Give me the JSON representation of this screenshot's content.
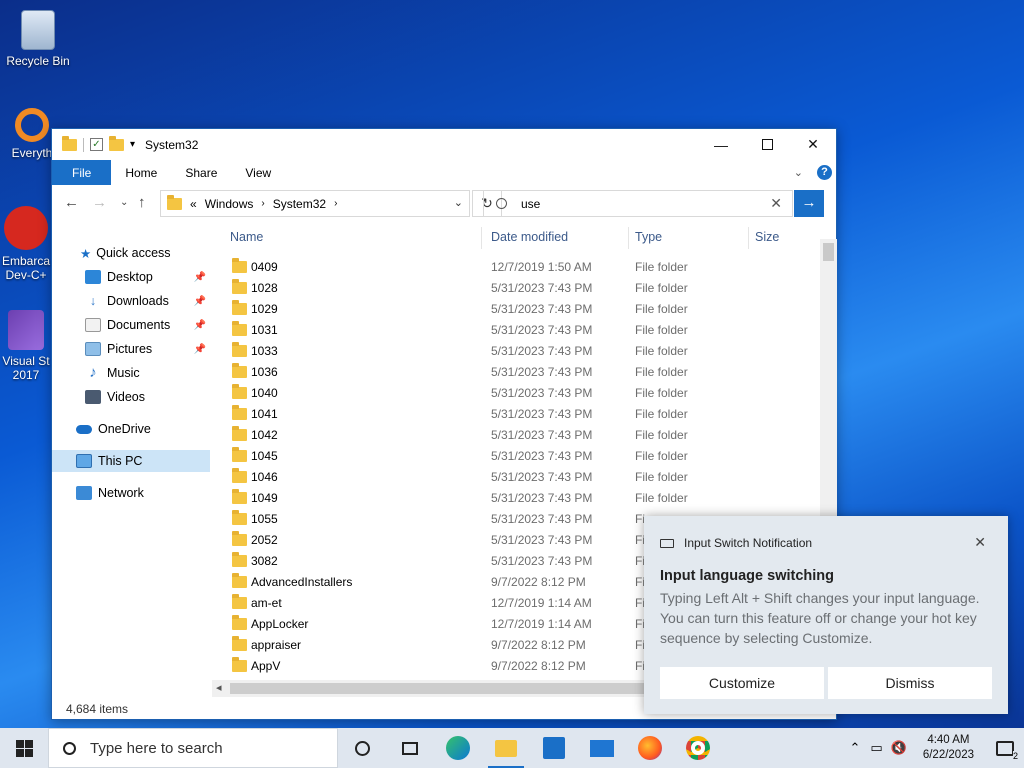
{
  "desktop": {
    "icons": [
      {
        "label": "Recycle Bin"
      },
      {
        "label": "Everyth"
      },
      {
        "label": "Embarca Dev-C+"
      },
      {
        "label": "Visual St 2017"
      }
    ]
  },
  "window": {
    "title": "System32",
    "ribbon_tabs": [
      "File",
      "Home",
      "Share",
      "View"
    ],
    "address": {
      "prefix": "«",
      "crumbs": [
        "Windows",
        "System32"
      ]
    },
    "search": {
      "value": "use"
    },
    "nav": {
      "quick_access": "Quick access",
      "items": [
        "Desktop",
        "Downloads",
        "Documents",
        "Pictures",
        "Music",
        "Videos"
      ],
      "onedrive": "OneDrive",
      "thispc": "This PC",
      "network": "Network"
    },
    "columns": [
      "Name",
      "Date modified",
      "Type",
      "Size"
    ],
    "rows": [
      {
        "name": "0409",
        "date": "12/7/2019 1:50 AM",
        "type": "File folder"
      },
      {
        "name": "1028",
        "date": "5/31/2023 7:43 PM",
        "type": "File folder"
      },
      {
        "name": "1029",
        "date": "5/31/2023 7:43 PM",
        "type": "File folder"
      },
      {
        "name": "1031",
        "date": "5/31/2023 7:43 PM",
        "type": "File folder"
      },
      {
        "name": "1033",
        "date": "5/31/2023 7:43 PM",
        "type": "File folder"
      },
      {
        "name": "1036",
        "date": "5/31/2023 7:43 PM",
        "type": "File folder"
      },
      {
        "name": "1040",
        "date": "5/31/2023 7:43 PM",
        "type": "File folder"
      },
      {
        "name": "1041",
        "date": "5/31/2023 7:43 PM",
        "type": "File folder"
      },
      {
        "name": "1042",
        "date": "5/31/2023 7:43 PM",
        "type": "File folder"
      },
      {
        "name": "1045",
        "date": "5/31/2023 7:43 PM",
        "type": "File folder"
      },
      {
        "name": "1046",
        "date": "5/31/2023 7:43 PM",
        "type": "File folder"
      },
      {
        "name": "1049",
        "date": "5/31/2023 7:43 PM",
        "type": "File folder"
      },
      {
        "name": "1055",
        "date": "5/31/2023 7:43 PM",
        "type": "Fi"
      },
      {
        "name": "2052",
        "date": "5/31/2023 7:43 PM",
        "type": "Fi"
      },
      {
        "name": "3082",
        "date": "5/31/2023 7:43 PM",
        "type": "Fi"
      },
      {
        "name": "AdvancedInstallers",
        "date": "9/7/2022 8:12 PM",
        "type": "Fi"
      },
      {
        "name": "am-et",
        "date": "12/7/2019 1:14 AM",
        "type": "Fi"
      },
      {
        "name": "AppLocker",
        "date": "12/7/2019 1:14 AM",
        "type": "Fi"
      },
      {
        "name": "appraiser",
        "date": "9/7/2022 8:12 PM",
        "type": "Fi"
      },
      {
        "name": "AppV",
        "date": "9/7/2022 8:12 PM",
        "type": "Fi"
      }
    ],
    "status": "4,684 items"
  },
  "toast": {
    "app": "Input Switch Notification",
    "title": "Input language switching",
    "body": "Typing Left Alt + Shift changes your input language. You can turn this feature off or change your hot key sequence by selecting Customize.",
    "customize": "Customize",
    "dismiss": "Dismiss"
  },
  "taskbar": {
    "search_placeholder": "Type here to search",
    "time": "4:40 AM",
    "date": "6/22/2023",
    "notif_count": "2"
  }
}
